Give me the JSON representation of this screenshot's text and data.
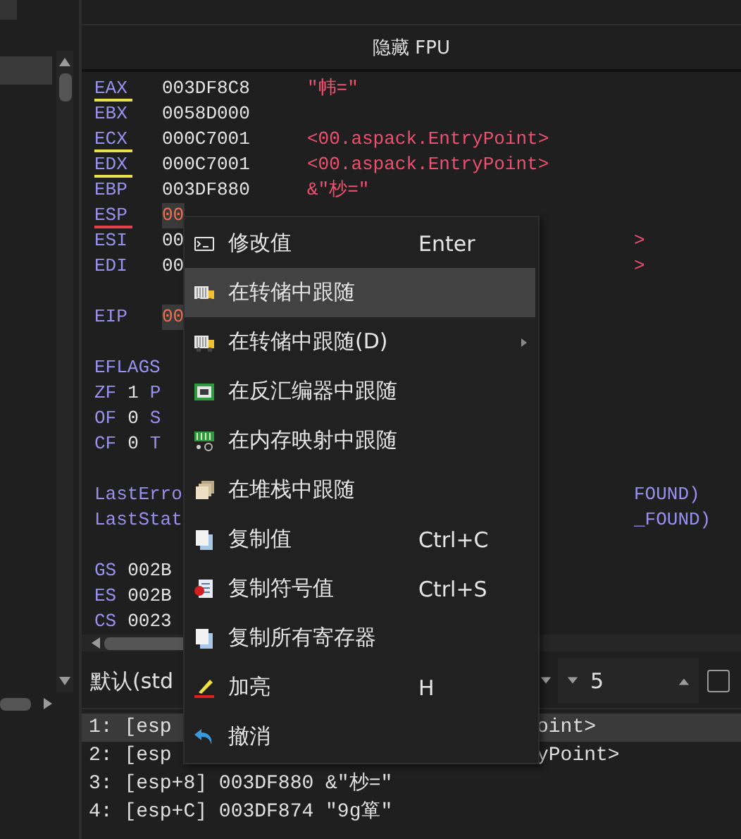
{
  "header": {
    "title": "隐藏 FPU"
  },
  "register_sections": [
    [
      {
        "kind": "reg",
        "name": "EAX",
        "value": "003DF8C8",
        "comment": "\"帏=\"",
        "color": "#e8e24a",
        "changed": false
      },
      {
        "kind": "reg",
        "name": "EBX",
        "value": "0058D000",
        "changed": false
      },
      {
        "kind": "reg",
        "name": "ECX",
        "value": "000C7001",
        "comment": "<00.aspack.EntryPoint>",
        "color": "#e8e24a",
        "changed": false
      },
      {
        "kind": "reg",
        "name": "EDX",
        "value": "000C7001",
        "comment": "<00.aspack.EntryPoint>",
        "color": "#e8e24a",
        "changed": false
      },
      {
        "kind": "reg",
        "name": "EBP",
        "value": "003DF880",
        "comment": "&\"杪=\"",
        "changed": false
      },
      {
        "kind": "reg",
        "name": "ESP",
        "value": "00",
        "color": "#e8404a",
        "changed": true
      },
      {
        "kind": "reg",
        "name": "ESI",
        "value": "00",
        "tail": ">",
        "changed": false
      },
      {
        "kind": "reg",
        "name": "EDI",
        "value": "00",
        "tail": ">",
        "changed": false
      }
    ],
    [
      {
        "kind": "reg",
        "name": "EIP",
        "value": "00",
        "changed": true
      }
    ],
    [
      {
        "kind": "text",
        "name": "EFLAGS"
      },
      {
        "kind": "flag",
        "name": "ZF",
        "value": "1",
        "cut": "P"
      },
      {
        "kind": "flag",
        "name": "OF",
        "value": "0",
        "cut": "S"
      },
      {
        "kind": "flag",
        "name": "CF",
        "value": "0",
        "cut": "T"
      }
    ],
    [
      {
        "kind": "text",
        "name": "LastErro",
        "tail": "FOUND)"
      },
      {
        "kind": "text",
        "name": "LastStat",
        "tail": "_FOUND)"
      }
    ],
    [
      {
        "kind": "flag",
        "name": "GS",
        "value": "002B"
      },
      {
        "kind": "flag",
        "name": "ES",
        "value": "002B"
      },
      {
        "kind": "flag",
        "name": "CS",
        "value": "0023"
      }
    ]
  ],
  "call_convention": {
    "value": "默认(std"
  },
  "arg_count": {
    "value": "5"
  },
  "option_checkbox": {
    "checked": false
  },
  "stack_args": [
    {
      "text": "1: [esp",
      "tail": "oint>",
      "selected": true
    },
    {
      "text": "2: [esp",
      "tail": "yPoint>",
      "selected": false
    },
    {
      "text": "3: [esp+8] 003DF880 &\"杪=\"",
      "selected": false
    },
    {
      "text": "4: [esp+C] 003DF874 \"9g箪\"",
      "selected": false
    }
  ],
  "context_menu": [
    {
      "kind": "edit",
      "label": "修改值",
      "shortcut": "Enter",
      "selected": false
    },
    {
      "kind": "dump",
      "label": "在转储中跟随",
      "selected": true
    },
    {
      "kind": "dump",
      "label": "在转储中跟随(D)",
      "submenu": true,
      "selected": false
    },
    {
      "kind": "disasm",
      "label": "在反汇编器中跟随",
      "selected": false
    },
    {
      "kind": "memmap",
      "label": "在内存映射中跟随",
      "selected": false
    },
    {
      "kind": "stack",
      "label": "在堆栈中跟随",
      "selected": false
    },
    {
      "kind": "copy",
      "label": "复制值",
      "shortcut": "Ctrl+C",
      "selected": false
    },
    {
      "kind": "copysym",
      "label": "复制符号值",
      "shortcut": "Ctrl+S",
      "selected": false
    },
    {
      "kind": "copy",
      "label": "复制所有寄存器",
      "selected": false
    },
    {
      "kind": "highlight",
      "label": "加亮",
      "shortcut": "H",
      "selected": false
    },
    {
      "kind": "undo",
      "label": "撤消",
      "selected": false
    }
  ]
}
